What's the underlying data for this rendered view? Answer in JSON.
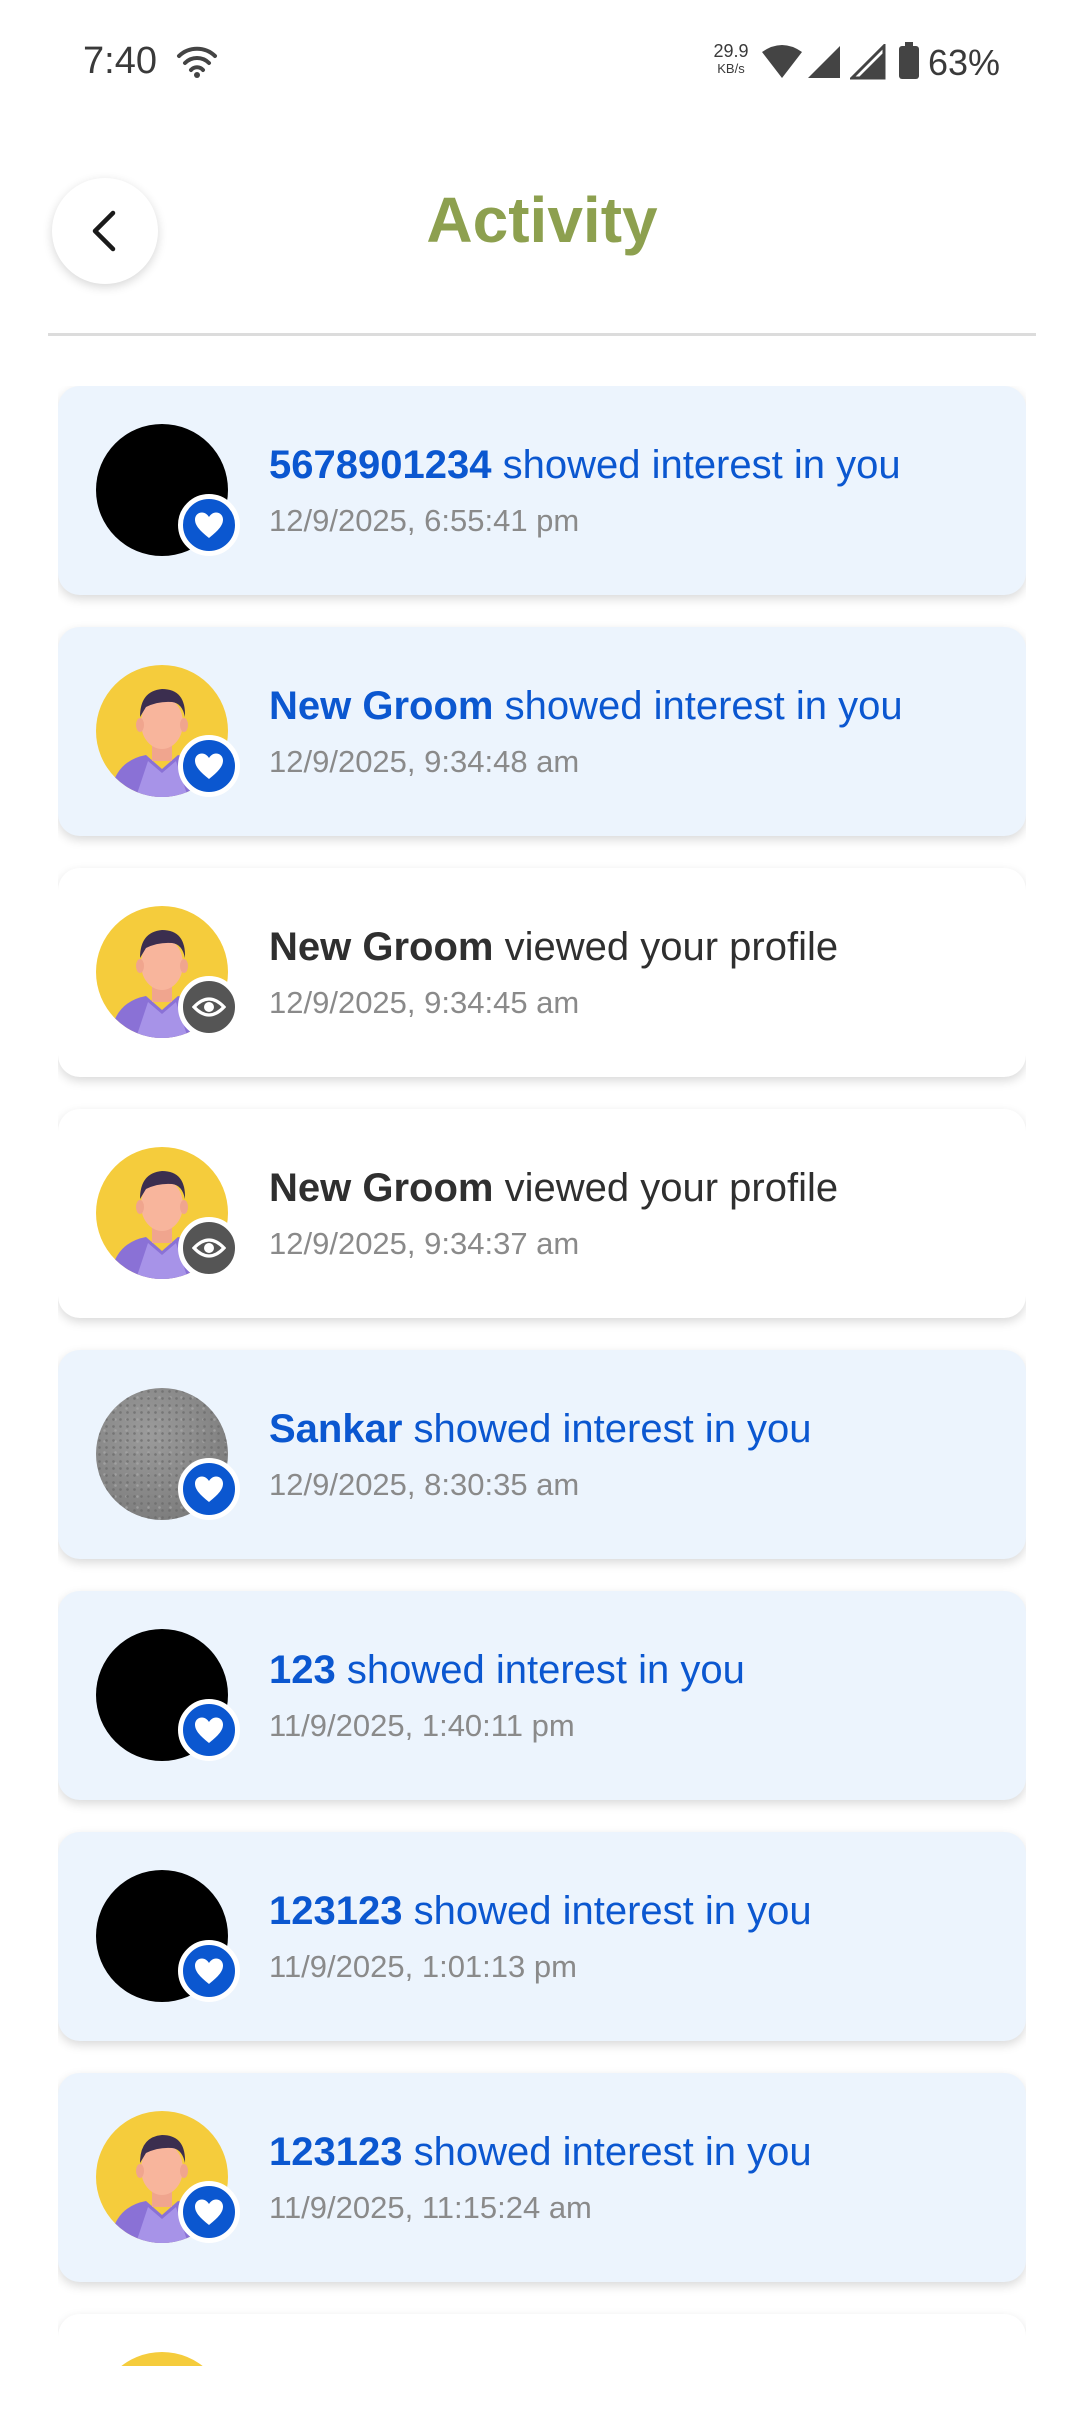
{
  "status_bar": {
    "time": "7:40",
    "speed_value": "29.9",
    "speed_unit": "KB/s",
    "battery": "63%"
  },
  "header": {
    "title": "Activity",
    "back_icon": "chevron-left-icon"
  },
  "colors": {
    "title": "#8da04f",
    "interest_text": "#0b57d0",
    "interest_card_bg": "#ecf4fd",
    "view_card_bg": "#ffffff",
    "heart_badge": "#0b57d0",
    "eye_badge": "#555555",
    "timestamp": "#8a8a8a"
  },
  "activities": [
    {
      "type": "interest",
      "name": "5678901234",
      "action": " showed interest in you",
      "time": "12/9/2025, 6:55:41 pm",
      "avatar": "black",
      "badge_icon": "heart-icon"
    },
    {
      "type": "interest",
      "name": "New Groom",
      "action": " showed interest in you",
      "time": "12/9/2025, 9:34:48 am",
      "avatar": "man",
      "badge_icon": "heart-icon"
    },
    {
      "type": "view",
      "name": "New Groom",
      "action": " viewed your profile",
      "time": "12/9/2025, 9:34:45 am",
      "avatar": "man",
      "badge_icon": "eye-icon"
    },
    {
      "type": "view",
      "name": "New Groom",
      "action": " viewed your profile",
      "time": "12/9/2025, 9:34:37 am",
      "avatar": "man",
      "badge_icon": "eye-icon"
    },
    {
      "type": "interest",
      "name": "Sankar",
      "action": " showed interest in you",
      "time": "12/9/2025, 8:30:35 am",
      "avatar": "gray",
      "badge_icon": "heart-icon"
    },
    {
      "type": "interest",
      "name": "123",
      "action": " showed interest in you",
      "time": "11/9/2025, 1:40:11 pm",
      "avatar": "black",
      "badge_icon": "heart-icon"
    },
    {
      "type": "interest",
      "name": "123123",
      "action": " showed interest in you",
      "time": "11/9/2025, 1:01:13 pm",
      "avatar": "black",
      "badge_icon": "heart-icon"
    },
    {
      "type": "interest",
      "name": "123123",
      "action": " showed interest in you",
      "time": "11/9/2025, 11:15:24 am",
      "avatar": "man",
      "badge_icon": "heart-icon"
    },
    {
      "type": "view",
      "name": "",
      "action": "",
      "time": "",
      "avatar": "man",
      "badge_icon": "eye-icon"
    }
  ]
}
